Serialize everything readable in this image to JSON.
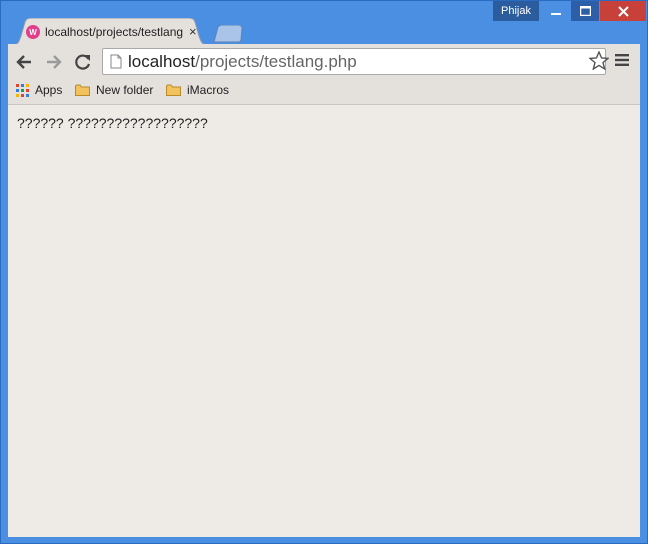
{
  "window": {
    "profile_name": "Phijak",
    "accent_color": "#4a8fe2",
    "close_color": "#c7403a"
  },
  "tab": {
    "title": "localhost/projects/testlang.php",
    "favicon_letter": "W",
    "close_glyph": "×"
  },
  "toolbar": {
    "url_host": "localhost",
    "url_path": "/projects/testlang.php",
    "icons": [
      "back-arrow-icon",
      "forward-arrow-icon",
      "reload-icon",
      "page-icon",
      "star-icon",
      "menu-icon"
    ]
  },
  "bookmarks": [
    {
      "label": "Apps",
      "icon": "apps-grid-icon"
    },
    {
      "label": "New folder",
      "icon": "folder-icon"
    },
    {
      "label": "iMacros",
      "icon": "folder-icon"
    }
  ],
  "page": {
    "text": "?????? ??????????????????"
  }
}
